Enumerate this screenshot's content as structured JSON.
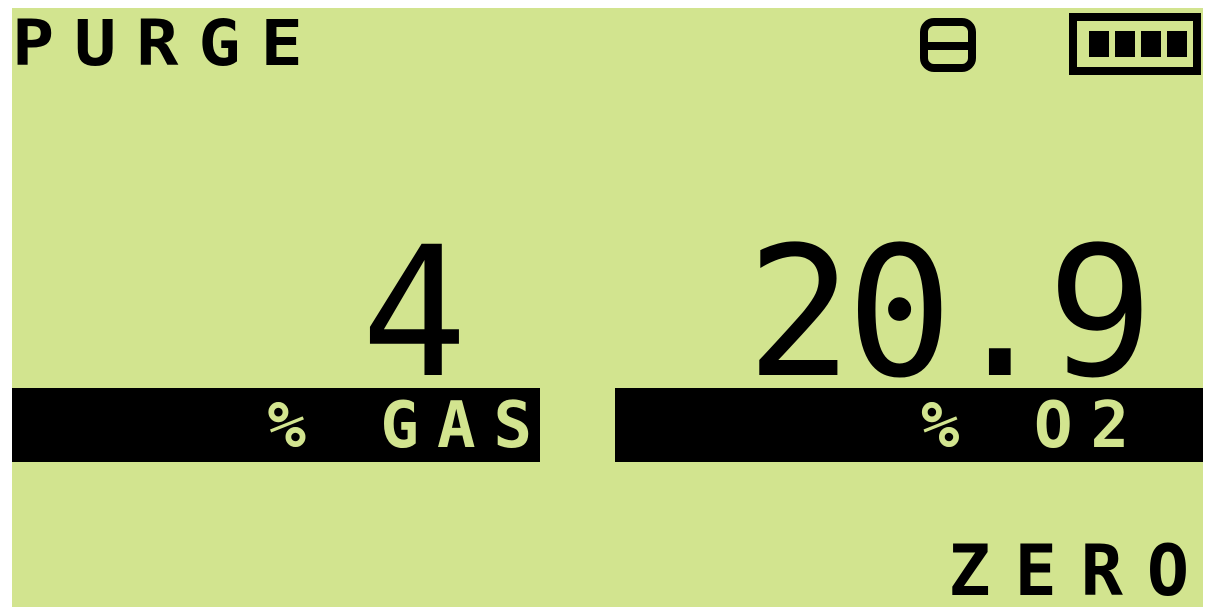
{
  "display": {
    "mode_label": "PURGE",
    "gas": {
      "value": "4",
      "label": "% GAS"
    },
    "o2": {
      "value": "20.9",
      "label": "% O2"
    },
    "function_label": "ZERO"
  },
  "icons": {
    "status_icon": "pump-status-icon",
    "battery_icon": "battery-full-icon"
  },
  "colors": {
    "lcd_background": "#d2e48f",
    "pixel_on": "#000000"
  },
  "battery": {
    "level": 1.0
  }
}
